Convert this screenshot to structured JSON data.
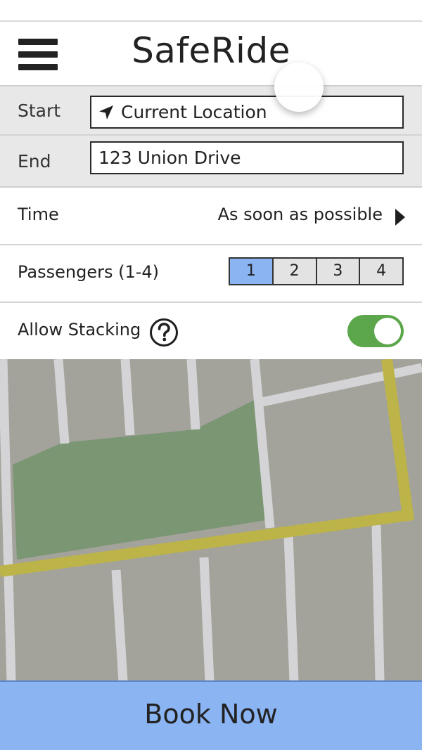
{
  "header": {
    "title": "SafeRide",
    "menu_icon": "hamburger-menu-icon"
  },
  "route": {
    "start_label": "Start",
    "start_value": "Current Location",
    "start_icon": "location-arrow-icon",
    "end_label": "End",
    "end_value": "123 Union Drive"
  },
  "options": {
    "time_label": "Time",
    "time_value": "As soon as possible",
    "passengers_label": "Passengers (1-4)",
    "passenger_choices": [
      "1",
      "2",
      "3",
      "4"
    ],
    "passengers_selected": "1",
    "stacking_label": "Allow Stacking",
    "stacking_help_icon": "question-circle-icon",
    "stacking_enabled": true
  },
  "book_button_label": "Book Now",
  "colors": {
    "accent_blue": "#8ab4f2",
    "toggle_green": "#5ca64c",
    "map_base": "#a3a29b",
    "map_park": "#7a9673",
    "map_road": "#d4d4d6",
    "map_route": "#bdb449"
  }
}
